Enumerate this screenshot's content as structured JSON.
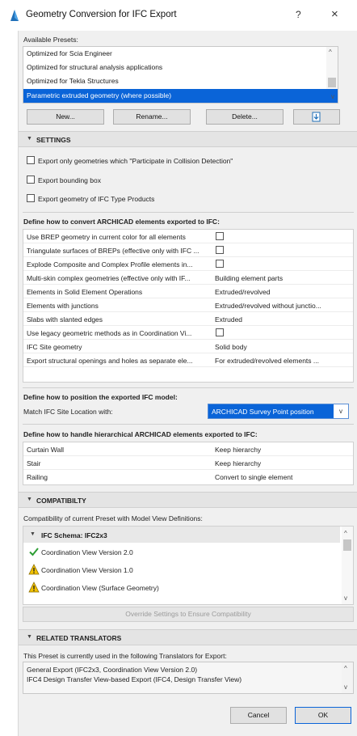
{
  "window": {
    "title": "Geometry Conversion for IFC Export",
    "help_glyph": "?",
    "close_glyph": "×",
    "icon": "archicad-app-icon"
  },
  "presets": {
    "label": "Available Presets:",
    "items": [
      "Optimized for Scia Engineer",
      "Optimized for structural analysis applications",
      "Optimized for Tekla Structures",
      "Parametric extruded geometry (where possible)"
    ],
    "selected_index": 3,
    "buttons": {
      "new": "New...",
      "rename": "Rename...",
      "delete": "Delete...",
      "import_icon": "import-icon"
    }
  },
  "settings": {
    "title": "SETTINGS",
    "checkboxes": [
      {
        "label": "Export only geometries which \"Participate in Collision Detection\"",
        "checked": false
      },
      {
        "label": "Export bounding box",
        "checked": false
      },
      {
        "label": "Export geometry of IFC Type Products",
        "checked": false
      }
    ]
  },
  "convert": {
    "heading": "Define how to convert ARCHICAD elements exported to IFC:",
    "rows": [
      {
        "name": "Use BREP geometry in current color for all elements",
        "type": "checkbox",
        "checked": false
      },
      {
        "name": "Triangulate surfaces of BREPs (effective only with IFC ...",
        "type": "checkbox",
        "checked": false
      },
      {
        "name": "Explode Composite and Complex Profile elements in...",
        "type": "checkbox",
        "checked": false
      },
      {
        "name": "Multi-skin complex geometries (effective only with IF...",
        "type": "text",
        "value": "Building element parts"
      },
      {
        "name": "Elements in Solid Element Operations",
        "type": "text",
        "value": "Extruded/revolved"
      },
      {
        "name": "Elements with junctions",
        "type": "text",
        "value": "Extruded/revolved without junctio..."
      },
      {
        "name": "Slabs with slanted edges",
        "type": "text",
        "value": "Extruded"
      },
      {
        "name": "Use legacy geometric methods as in Coordination Vi...",
        "type": "checkbox",
        "checked": false
      },
      {
        "name": "IFC Site geometry",
        "type": "text",
        "value": "Solid body"
      },
      {
        "name": "Export structural openings and holes as separate ele...",
        "type": "text",
        "value": "For extruded/revolved elements ..."
      }
    ]
  },
  "position": {
    "heading": "Define how to position the exported IFC model:",
    "match_label": "Match IFC Site Location with:",
    "selected": "ARCHICAD Survey Point position"
  },
  "hierarchy": {
    "heading": "Define how to handle hierarchical ARCHICAD elements exported to IFC:",
    "rows": [
      {
        "name": "Curtain Wall",
        "value": "Keep hierarchy"
      },
      {
        "name": "Stair",
        "value": "Keep hierarchy"
      },
      {
        "name": "Railing",
        "value": "Convert to single element"
      }
    ]
  },
  "compatibility": {
    "title": "COMPATIBILTY",
    "description": "Compatibility of current Preset with Model View Definitions:",
    "schema_label": "IFC Schema: IFC2x3",
    "items": [
      {
        "label": "Coordination View Version 2.0",
        "status": "check-icon"
      },
      {
        "label": "Coordination View Version 1.0",
        "status": "warning-icon"
      },
      {
        "label": "Coordination View (Surface Geometry)",
        "status": "warning-icon"
      }
    ],
    "override_button": "Override Settings to Ensure Compatibility"
  },
  "related": {
    "title": "RELATED TRANSLATORS",
    "description": "This Preset is currently used in the following Translators for Export:",
    "lines": [
      "General Export (IFC2x3, Coordination View Version 2.0)",
      "IFC4 Design Transfer View-based Export (IFC4, Design Transfer View)"
    ]
  },
  "footer": {
    "cancel": "Cancel",
    "ok": "OK"
  },
  "colors": {
    "selection": "#0a64d8",
    "check_green": "#2e9e35",
    "warning_yellow": "#f2c200"
  }
}
